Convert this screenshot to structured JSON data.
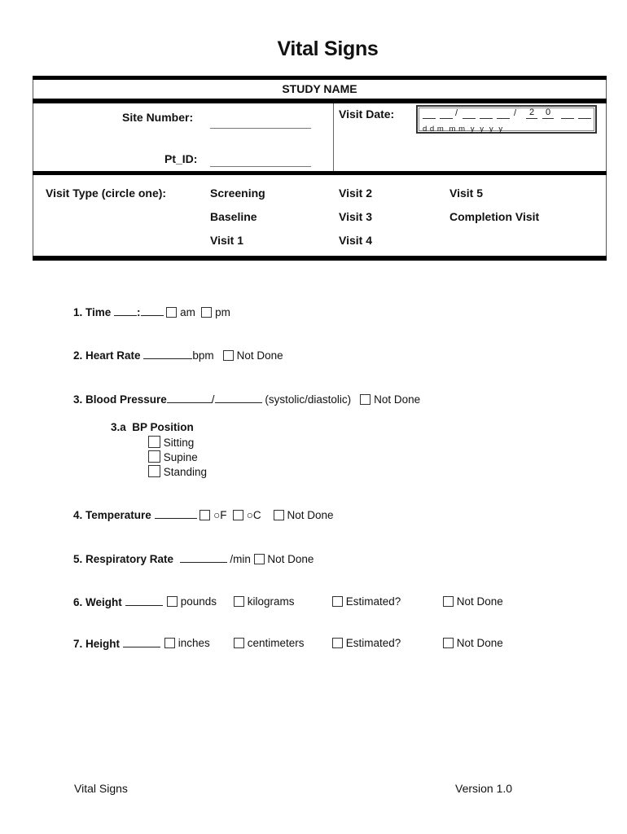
{
  "title": "Vital Signs",
  "header": {
    "study_name": "STUDY NAME",
    "site_number_label": "Site Number:",
    "site_number_value": "",
    "pt_id_label": "Pt_ID:",
    "pt_id_value": "",
    "visit_date_label": "Visit Date:",
    "visit_date": {
      "sep1": "/",
      "sep2": "/",
      "year_prefix_1": "2",
      "year_prefix_2": "0",
      "format_hint": "d d m  m m  y  y  y  y"
    }
  },
  "visit_type": {
    "label": "Visit Type (circle one):",
    "options": [
      "Screening",
      "Baseline",
      "Visit 1",
      "Visit 2",
      "Visit 3",
      "Visit 4",
      "Visit 5",
      "Completion Visit"
    ]
  },
  "questions": {
    "time": {
      "label": "1. Time",
      "sep": ":",
      "opt1": "am",
      "opt2": "pm"
    },
    "heart_rate": {
      "label": "2. Heart Rate",
      "unit": "bpm",
      "not_done": "Not Done"
    },
    "blood_pressure": {
      "label": "3. Blood Pressure",
      "sep": "/",
      "unit": "(systolic/diastolic)",
      "not_done": "Not Done"
    },
    "bp_position": {
      "label": "3.a  BP Position",
      "options": [
        "Sitting",
        "Supine",
        "Standing"
      ]
    },
    "temperature": {
      "label": "4. Temperature",
      "opt1": "○F",
      "opt2": "○C",
      "not_done": "Not Done"
    },
    "respiratory_rate": {
      "label": "5. Respiratory Rate",
      "unit": "/min",
      "not_done": "Not Done"
    },
    "weight": {
      "label": "6. Weight",
      "opt1": "pounds",
      "opt2": "kilograms",
      "estimated": "Estimated?",
      "not_done": "Not Done"
    },
    "height": {
      "label": "7. Height",
      "opt1": "inches",
      "opt2": "centimeters",
      "estimated": "Estimated?",
      "not_done": "Not Done"
    }
  },
  "footer": {
    "left": "Vital Signs",
    "right": "Version 1.0"
  }
}
